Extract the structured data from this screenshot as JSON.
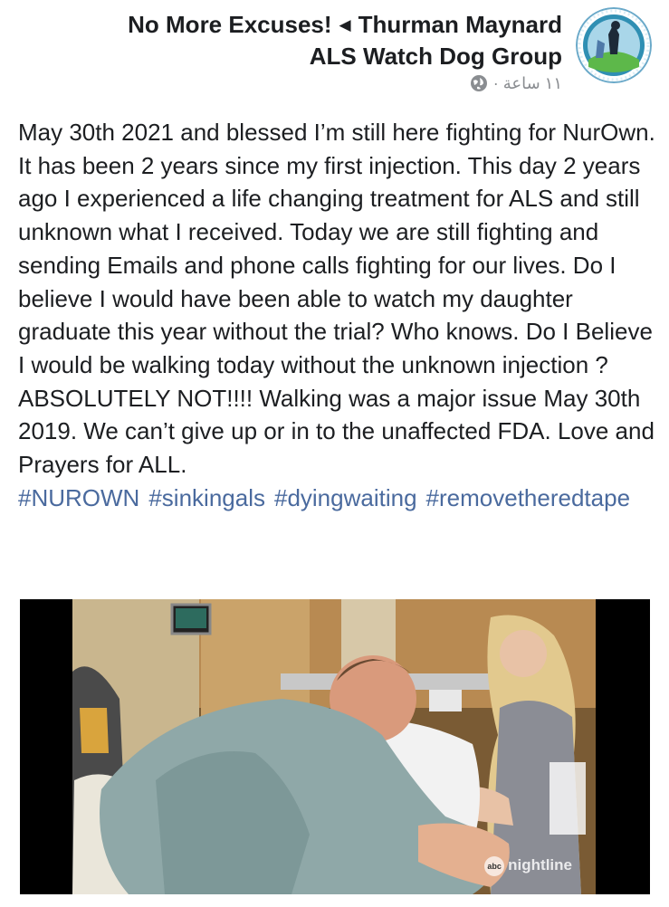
{
  "header": {
    "group_name": "No More Excuses!",
    "author_name": "Thurman Maynard",
    "group_line2": "ALS Watch Dog Group",
    "time_ago": "١١ ساعة ·",
    "privacy_icon": "globe-icon",
    "avatar_icon": "group-logo"
  },
  "post": {
    "body": "May 30th 2021 and blessed I’m still here fighting for NurOwn. It has been 2 years since my first injection. This day 2 years ago I experienced a life changing treatment for ALS and still unknown what I received. Today we are still fighting and sending Emails and phone calls fighting for our lives. Do I believe I would have been able to watch my daughter graduate this year without the trial? Who knows. Do I Believe I would be walking today without the unknown injection ? ABSOLUTELY NOT!!!! Walking was a major issue May 30th 2019. We can’t give up or in to the unaffected FDA. Love and Prayers for ALL.",
    "hashtags": [
      "#NUROWN",
      "#sinkingals",
      "#dyingwaiting",
      "#removetheredtape"
    ]
  },
  "media": {
    "watermark_abc": "abc",
    "watermark_text": "nightline"
  },
  "colors": {
    "text": "#1c1e21",
    "meta": "#8a8d91",
    "hashtag": "#4a6a9e"
  }
}
